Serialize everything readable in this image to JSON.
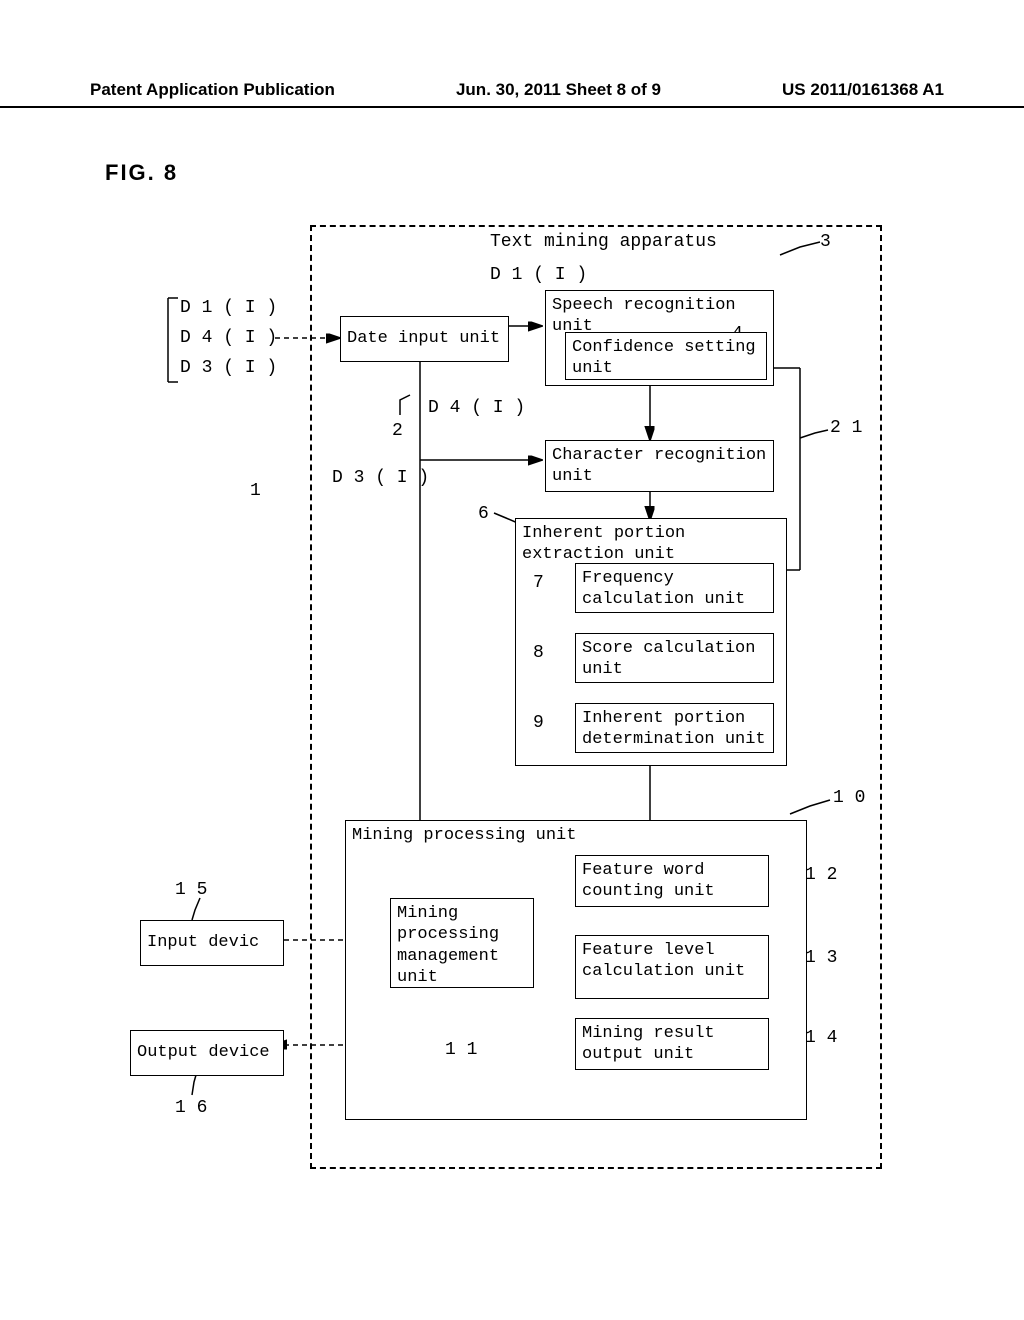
{
  "header": {
    "left": "Patent Application Publication",
    "center": "Jun. 30, 2011  Sheet 8 of 9",
    "right": "US 2011/0161368 A1"
  },
  "fig_label": "FIG. 8",
  "inputs": {
    "d1": "D 1  ( I )",
    "d4": "D 4  ( I )",
    "d3": "D 3  ( I )"
  },
  "refs": {
    "r1": "1",
    "r2": "2",
    "r3": "3",
    "r4": "4",
    "r6": "6",
    "r7": "7",
    "r8": "8",
    "r9": "9",
    "r10": "1 0",
    "r11": "1 1",
    "r12": "1 2",
    "r13": "1 3",
    "r14": "1 4",
    "r15": "1 5",
    "r16": "1 6",
    "r21": "2 1"
  },
  "signals": {
    "d1_mid": "D 1  ( I )",
    "d4_mid": "D 4  ( I )",
    "d3_mid": "D 3  ( I )"
  },
  "blocks": {
    "apparatus_title": "Text mining apparatus",
    "date_input": "Date input unit",
    "speech_rec": "Speech recognition unit",
    "confidence": "Confidence setting unit",
    "char_rec": "Character recognition unit",
    "inherent_ext": "Inherent portion extraction unit",
    "freq_calc": "Frequency calculation unit",
    "score_calc": "Score calculation unit",
    "inherent_det": "Inherent portion determination unit",
    "mining_proc": "Mining processing unit",
    "mining_mgmt": "Mining processing management unit",
    "feature_word": "Feature word counting unit",
    "feature_level": "Feature level calculation unit",
    "mining_result": "Mining result output unit",
    "input_device": "Input devic",
    "output_device": "Output device"
  }
}
